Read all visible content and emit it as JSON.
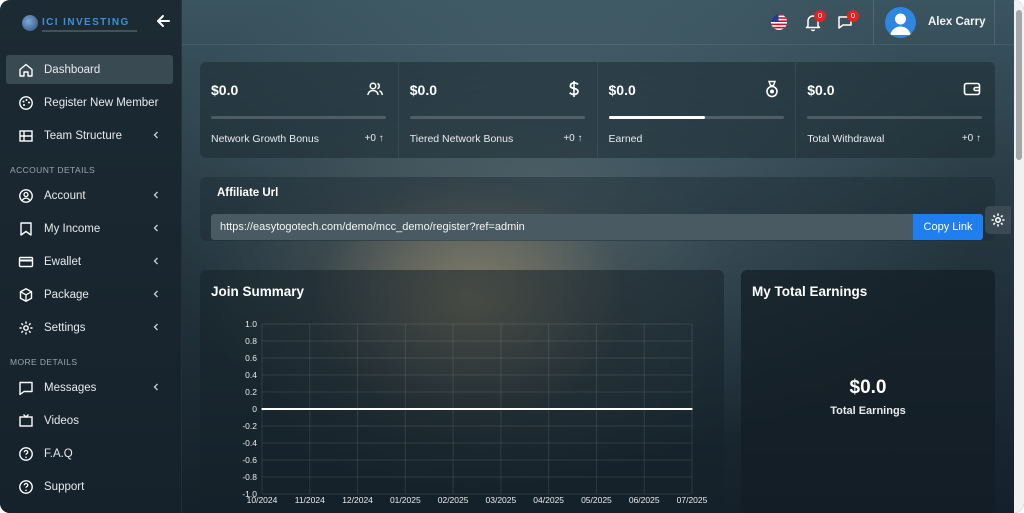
{
  "brand": {
    "name": "ICI INVESTING"
  },
  "sidebar": {
    "items": [
      {
        "label": "Dashboard",
        "active": true
      },
      {
        "label": "Register New Member"
      },
      {
        "label": "Team Structure",
        "has_children": true
      }
    ],
    "sections": [
      {
        "title": "ACCOUNT DETAILS",
        "items": [
          {
            "label": "Account"
          },
          {
            "label": "My Income"
          },
          {
            "label": "Ewallet"
          },
          {
            "label": "Package"
          },
          {
            "label": "Settings"
          }
        ]
      },
      {
        "title": "MORE DETAILS",
        "items": [
          {
            "label": "Messages"
          },
          {
            "label": "Videos"
          },
          {
            "label": "F.A.Q"
          },
          {
            "label": "Support"
          }
        ]
      }
    ]
  },
  "header": {
    "notifications_count": "0",
    "messages_count": "0",
    "user_name": "Alex Carry"
  },
  "stats": [
    {
      "amount": "$0.0",
      "label": "Network Growth Bonus",
      "delta": "+0",
      "icon": "users-icon",
      "progress": 0
    },
    {
      "amount": "$0.0",
      "label": "Tiered Network Bonus",
      "delta": "+0",
      "icon": "dollar-icon",
      "progress": 0
    },
    {
      "amount": "$0.0",
      "label": "Earned",
      "delta": "",
      "icon": "medal-icon",
      "progress": 0.55
    },
    {
      "amount": "$0.0",
      "label": "Total Withdrawal",
      "delta": "+0",
      "icon": "wallet-icon",
      "progress": 0
    }
  ],
  "affiliate": {
    "title": "Affiliate Url",
    "url": "https://easytogotech.com/demo/mcc_demo/register?ref=admin",
    "copy_label": "Copy Link"
  },
  "join_summary": {
    "title": "Join Summary"
  },
  "earnings": {
    "title": "My Total Earnings",
    "amount": "$0.0",
    "label": "Total Earnings"
  },
  "colors": {
    "accent": "#1f7ef0",
    "badge": "#e02424",
    "avatar": "#2f86e0"
  },
  "chart_data": {
    "type": "line",
    "x": [
      "10/2024",
      "11/2024",
      "12/2024",
      "01/2025",
      "02/2025",
      "03/2025",
      "04/2025",
      "05/2025",
      "06/2025",
      "07/2025"
    ],
    "series": [
      {
        "values": [
          0,
          0,
          0,
          0,
          0,
          0,
          0,
          0,
          0,
          0
        ]
      }
    ],
    "yticks": [
      "1.0",
      "0.8",
      "0.6",
      "0.4",
      "0.2",
      "0",
      "-0.2",
      "-0.4",
      "-0.6",
      "-0.8",
      "-1.0"
    ],
    "ylim": [
      -1,
      1
    ],
    "grid": true
  }
}
